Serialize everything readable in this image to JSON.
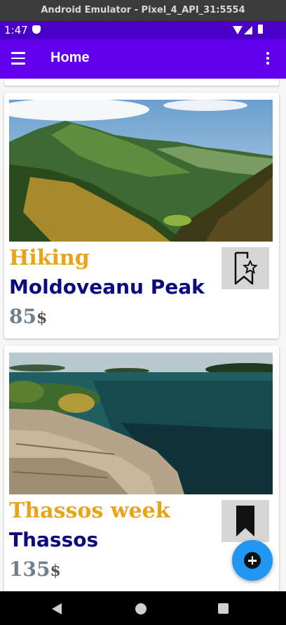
{
  "window": {
    "title": "Android Emulator - Pixel_4_API_31:5554"
  },
  "status_bar": {
    "time": "1:47"
  },
  "app_bar": {
    "title": "Home"
  },
  "trips": [
    {
      "kind": "Hiking",
      "name": "Moldoveanu Peak",
      "price": "85",
      "currency": "$",
      "favorite": false,
      "favorite_icon": "bookmark-star-outline-icon"
    },
    {
      "kind": "Thassos week",
      "name": "Thassos",
      "price": "135",
      "currency": "$",
      "favorite": true,
      "favorite_icon": "bookmark-filled-icon"
    }
  ],
  "fab": {
    "icon": "add-circle-icon",
    "color": "#2196f3"
  },
  "colors": {
    "app_bar": "#6200ee",
    "status_bar": "#4a00c8",
    "kind_text": "#e8a317",
    "name_text": "#0d0a80",
    "price_text": "#6e7f90"
  }
}
